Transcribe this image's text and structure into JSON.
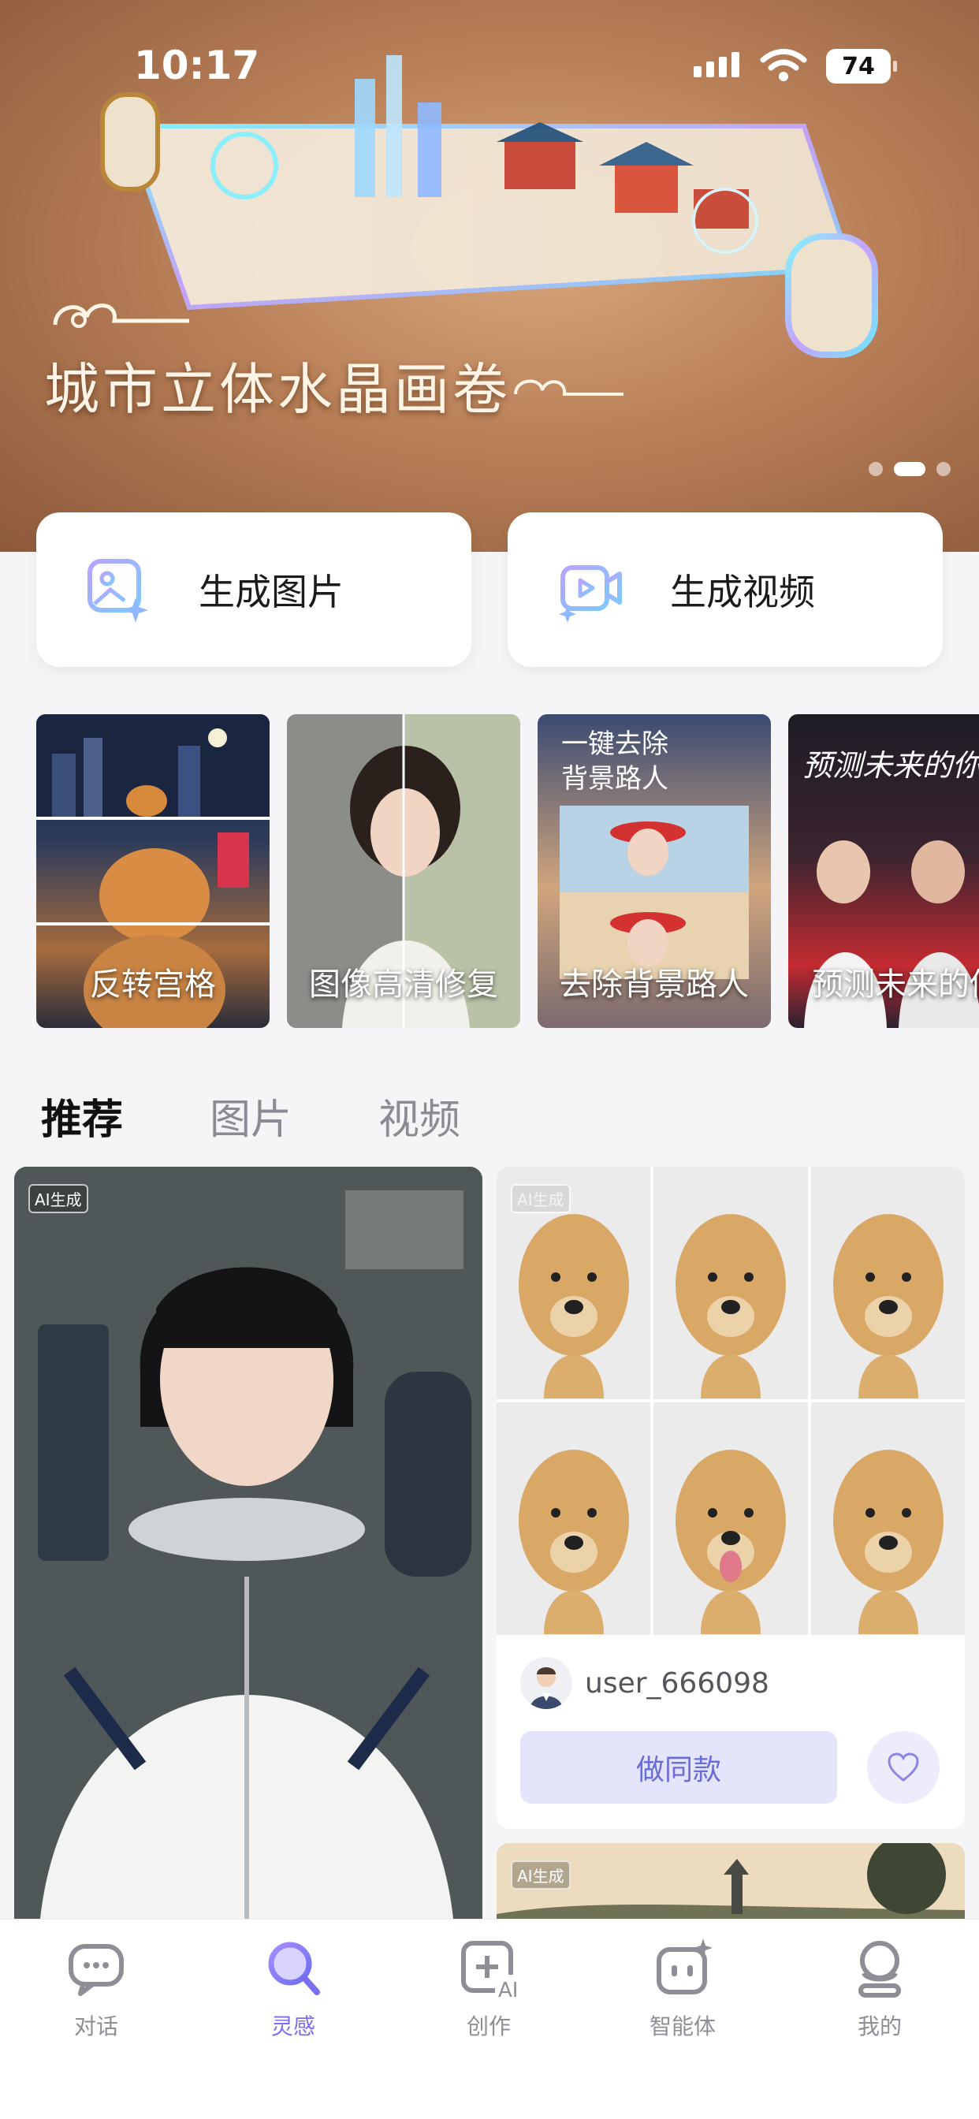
{
  "status_bar": {
    "time": "10:17",
    "battery": "74"
  },
  "banner": {
    "title": "城市立体水晶画卷",
    "slides": 3,
    "active_slide": 2
  },
  "actions": [
    {
      "label": "生成图片",
      "icon": "image-sparkle-icon"
    },
    {
      "label": "生成视频",
      "icon": "video-sparkle-icon"
    }
  ],
  "features": [
    {
      "label": "反转宫格"
    },
    {
      "label": "图像高清修复"
    },
    {
      "label": "去除背景路人",
      "overlay": "一键去除\n背景路人"
    },
    {
      "label": "预测未来的你",
      "overlay": "预测未来的你"
    }
  ],
  "tabs": [
    {
      "label": "推荐",
      "active": true
    },
    {
      "label": "图片",
      "active": false
    },
    {
      "label": "视频",
      "active": false
    }
  ],
  "feed": {
    "ai_badge": "AI生成",
    "card2": {
      "username": "user_666098",
      "same_button": "做同款"
    }
  },
  "nav": [
    {
      "label": "对话",
      "icon": "chat-icon",
      "active": false
    },
    {
      "label": "灵感",
      "icon": "search-icon",
      "active": true
    },
    {
      "label": "创作",
      "icon": "create-ai-icon",
      "active": false
    },
    {
      "label": "智能体",
      "icon": "agent-icon",
      "active": false
    },
    {
      "label": "我的",
      "icon": "profile-icon",
      "active": false
    }
  ]
}
